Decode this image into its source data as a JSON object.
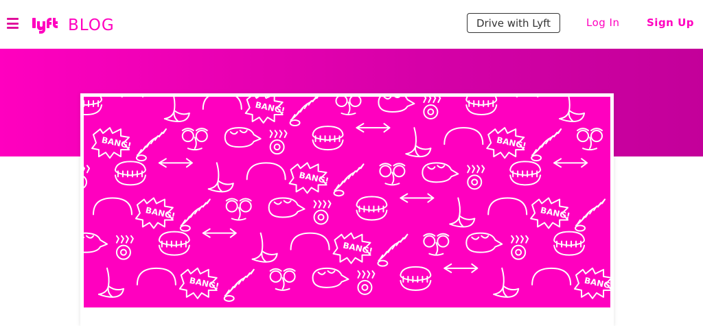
{
  "header": {
    "menu_icon": "hamburger-menu-icon",
    "logo_text": "lyft",
    "blog_label": "BLOG",
    "drive_button": "Drive with Lyft",
    "login_link": "Log In",
    "signup_link": "Sign Up"
  },
  "colors": {
    "brand_pink": "#ff00bf",
    "hero_gradient_end": "#c3009a",
    "button_border": "#333333"
  },
  "hero": {
    "image": {
      "description_icon": "pattern-illustration",
      "pattern_text": "BANG!"
    }
  }
}
